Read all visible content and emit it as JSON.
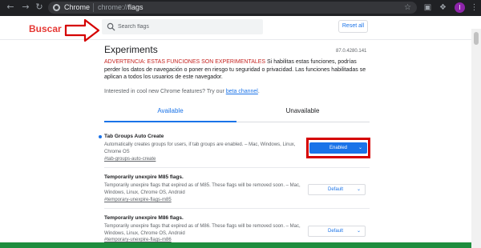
{
  "browser": {
    "site_label": "Chrome",
    "url_scheme": "chrome://",
    "url_path": "flags",
    "profile_initial": "I"
  },
  "header": {
    "annotation_label": "Buscar",
    "search_placeholder": "Search flags",
    "reset_label": "Reset all"
  },
  "main": {
    "title": "Experiments",
    "version": "87.0.4280.141",
    "warning_strong": "ADVERTENCIA: ESTAS FUNCIONES SON EXPERIMENTALES",
    "warning_rest": " Si habilitas estas funciones, podrías perder los datos de navegación o poner en riesgo tu seguridad o privacidad. Las funciones habilitadas se aplican a todos los usuarios de este navegador.",
    "interested_text": "Interested in cool new Chrome features? Try our ",
    "beta_link": "beta channel",
    "interested_end": ".",
    "tabs": [
      {
        "label": "Available",
        "active": true
      },
      {
        "label": "Unavailable",
        "active": false
      }
    ]
  },
  "flags": [
    {
      "name": "Tab Groups Auto Create",
      "description": "Automatically creates groups for users, if tab groups are enabled. – Mac, Windows, Linux, Chrome OS",
      "link": "#tab-groups-auto-create",
      "value": "Enabled"
    },
    {
      "name": "Temporarily unexpire M85 flags.",
      "description": "Temporarily unexpire flags that expired as of M85. These flags will be removed soon. – Mac, Windows, Linux, Chrome OS, Android",
      "link": "#temporary-unexpire-flags-m85",
      "value": "Default"
    },
    {
      "name": "Temporarily unexpire M86 flags.",
      "description": "Temporarily unexpire flags that expired as of M86. These flags will be removed soon. – Mac, Windows, Linux, Chrome OS, Android",
      "link": "#temporary-unexpire-flags-m86",
      "value": "Default"
    }
  ],
  "colors": {
    "accent": "#1a73e8",
    "warning": "#c5221f",
    "annotation": "#d50000"
  }
}
